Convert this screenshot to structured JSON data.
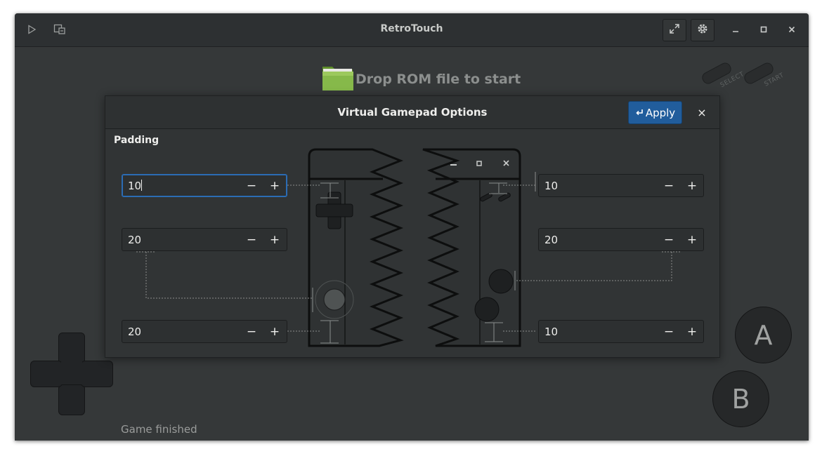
{
  "app": {
    "title": "RetroTouch"
  },
  "titlebar": {
    "left_icons": [
      "play-icon",
      "media-icon"
    ],
    "right_buttons": [
      "fullscreen-icon",
      "settings-icon"
    ],
    "window_controls": [
      "minimize-icon",
      "maximize-icon",
      "close-icon"
    ]
  },
  "main": {
    "drop_text": "Drop ROM file to start",
    "select_label": "SELECT",
    "start_label": "START",
    "status": "Game finished",
    "button_a": "A",
    "button_b": "B"
  },
  "dialog": {
    "title": "Virtual Gamepad Options",
    "apply_label": "Apply",
    "close_label": "×",
    "section_label": "Padding",
    "fields": {
      "left_top": "10",
      "left_middle": "20",
      "left_bottom": "20",
      "right_top": "10",
      "right_middle": "20",
      "right_bottom": "10"
    },
    "minus": "−",
    "plus": "+"
  },
  "colors": {
    "window_bg": "#353839",
    "titlebar_bg": "#2d3032",
    "accent": "#215d9c",
    "text": "#eeeeec",
    "folder": "#7fb13c"
  }
}
